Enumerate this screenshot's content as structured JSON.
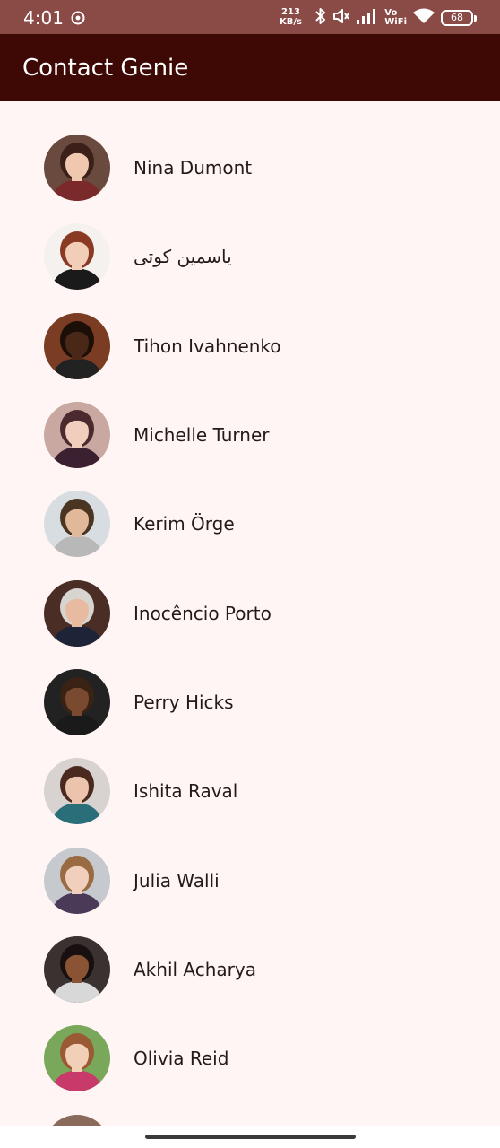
{
  "status_bar": {
    "time": "4:01",
    "speed_value": "213",
    "speed_unit": "KB/s",
    "network_label_top": "Vo",
    "network_label_bottom": "WiFi",
    "battery": "68",
    "background_color": "#8a4a46"
  },
  "app_bar": {
    "title": "Contact Genie",
    "background_color": "#3e0905"
  },
  "contacts": [
    {
      "name": "Nina Dumont",
      "avatar_bg": "#6a4a3e",
      "skin": "#f0c8b0",
      "hair": "#3a2018",
      "shirt": "#7a2a2a"
    },
    {
      "name": "ياسمين كوتی",
      "avatar_bg": "#f4f1ef",
      "skin": "#f2cdb8",
      "hair": "#8a3a22",
      "shirt": "#1a1a1a"
    },
    {
      "name": "Tihon Ivahnenko",
      "avatar_bg": "#7a3c22",
      "skin": "#4a2818",
      "hair": "#1c0f08",
      "shirt": "#222222"
    },
    {
      "name": "Michelle Turner",
      "avatar_bg": "#c8a8a0",
      "skin": "#f0cdbd",
      "hair": "#4a2a2e",
      "shirt": "#3a2030"
    },
    {
      "name": "Kerim Örge",
      "avatar_bg": "#d8dde2",
      "skin": "#e2b89a",
      "hair": "#4a3422",
      "shirt": "#b8b8b8"
    },
    {
      "name": "Inocêncio Porto",
      "avatar_bg": "#4a2e26",
      "skin": "#e8bba0",
      "hair": "#d8d4d0",
      "shirt": "#1e2438"
    },
    {
      "name": "Perry Hicks",
      "avatar_bg": "#222222",
      "skin": "#7a4a30",
      "hair": "#3a2214",
      "shirt": "#1a1a1a"
    },
    {
      "name": "Ishita Raval",
      "avatar_bg": "#d8d2d0",
      "skin": "#ecc4ae",
      "hair": "#4a2a1e",
      "shirt": "#2a6e7a"
    },
    {
      "name": "Julia Walli",
      "avatar_bg": "#c6cacf",
      "skin": "#f0d0bc",
      "hair": "#9a6a42",
      "shirt": "#4a3a58"
    },
    {
      "name": "Akhil Acharya",
      "avatar_bg": "#3a3230",
      "skin": "#8a5434",
      "hair": "#181010",
      "shirt": "#d8d8d8"
    },
    {
      "name": "Olivia Reid",
      "avatar_bg": "#7aa85a",
      "skin": "#f2d0b8",
      "hair": "#9a5a34",
      "shirt": "#c83a6a"
    }
  ]
}
